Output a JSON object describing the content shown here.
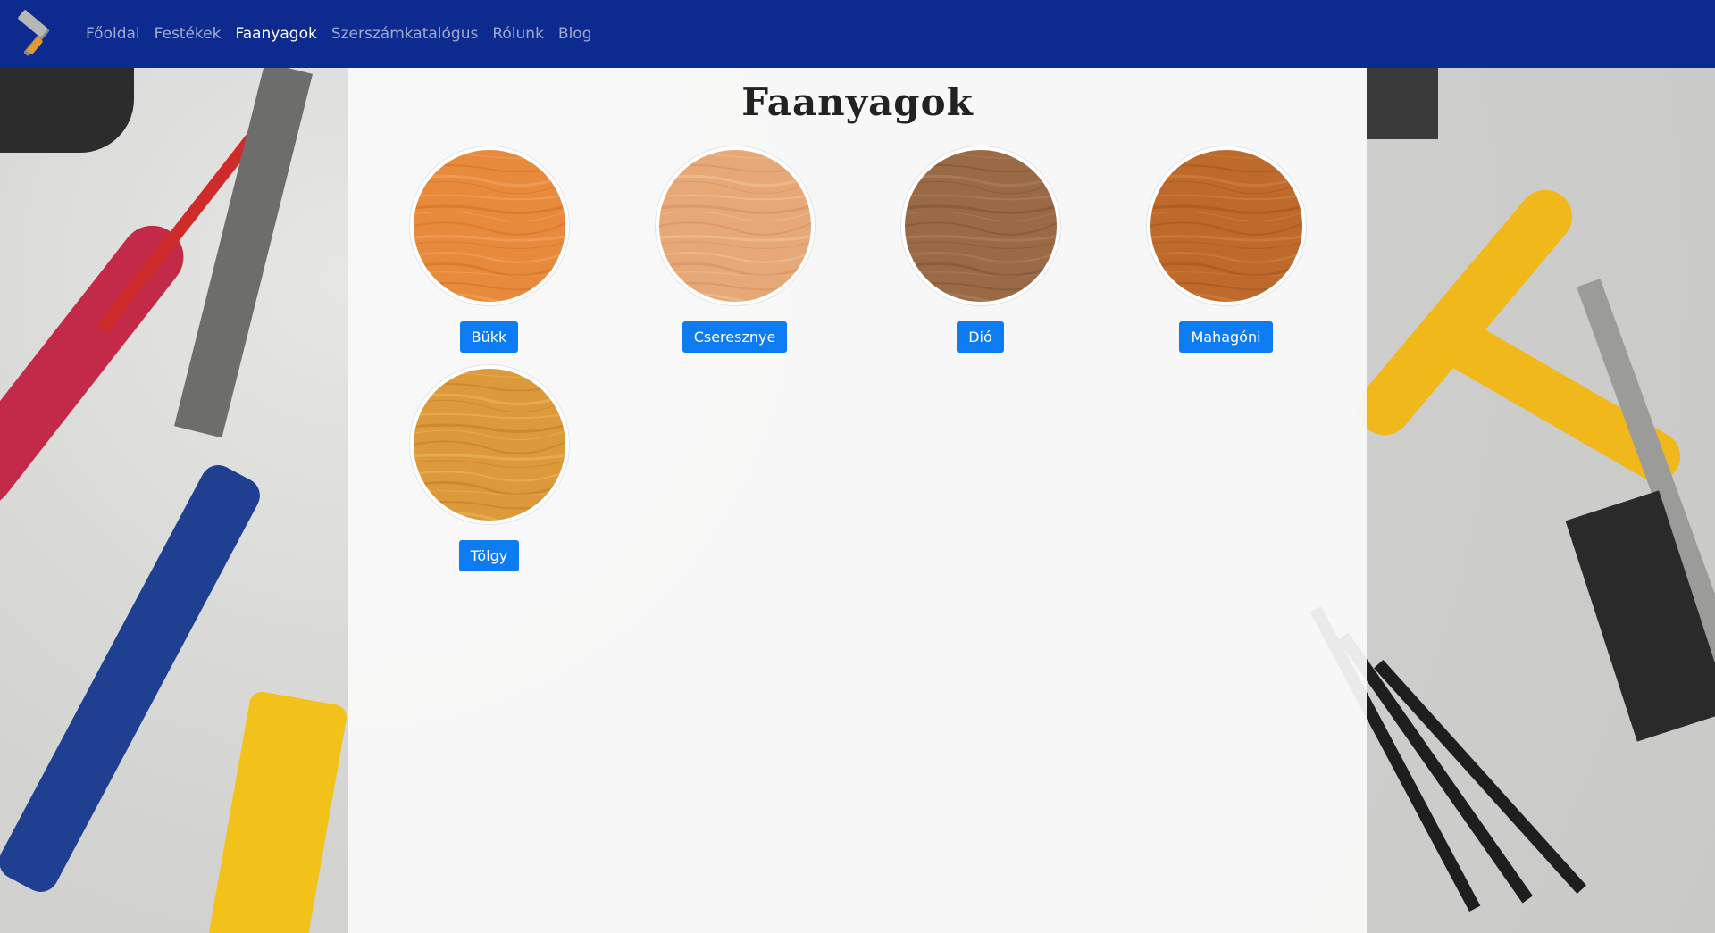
{
  "navbar": {
    "brand_icon": "hammer-icon",
    "links": [
      {
        "label": "Főoldal",
        "active": false
      },
      {
        "label": "Festékek",
        "active": false
      },
      {
        "label": "Faanyagok",
        "active": true
      },
      {
        "label": "Szerszámkatalógus",
        "active": false
      },
      {
        "label": "Rólunk",
        "active": false
      },
      {
        "label": "Blog",
        "active": false
      }
    ],
    "color": "#0d2a8e"
  },
  "main": {
    "title": "Faanyagok",
    "woods": [
      {
        "name": "Bükk",
        "base": "#e88a3c",
        "light": "#f3a867",
        "dark": "#cf6f22"
      },
      {
        "name": "Cseresznye",
        "base": "#e7a878",
        "light": "#f2c49d",
        "dark": "#cf8e5c"
      },
      {
        "name": "Dió",
        "base": "#9a6a46",
        "light": "#b48462",
        "dark": "#7b5234"
      },
      {
        "name": "Mahagóni",
        "base": "#bd6a2c",
        "light": "#d48544",
        "dark": "#9e5420"
      },
      {
        "name": "Tölgy",
        "base": "#dc9a3a",
        "light": "#eeb961",
        "dark": "#bf7d22"
      }
    ],
    "button_color": "#0d7bf2"
  }
}
